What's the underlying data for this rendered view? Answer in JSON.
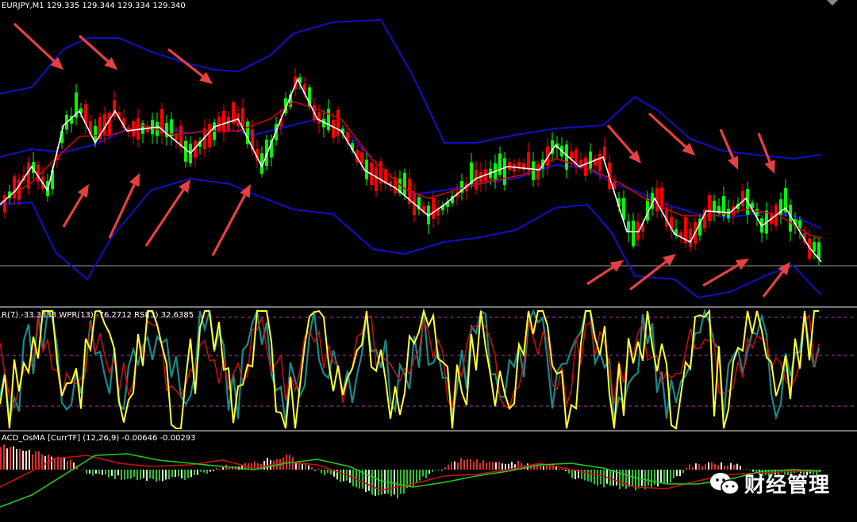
{
  "header": {
    "symbol_line": "EURJPY,M1  129.335 129.344 129.334 129.340"
  },
  "oscillator_header": "R(7) -33.3333  WPR(13) -76.2712  RSI(3) 32.6385",
  "macd_header": "ACD_OsMA [CurrTF] (12,26,9) -0.00646 -0.00293",
  "watermark": {
    "text": "财经管理",
    "icon": "wechat-icon"
  },
  "colors": {
    "bull": "#00ff00",
    "bear": "#ff0000",
    "bb": "#1010c8",
    "ma_fast": "#ffffff",
    "ma_slow": "#d00000",
    "arrow": "#e84040",
    "osc_a": "#ffff30",
    "osc_b": "#1a8a8a",
    "osc_c": "#cc1010",
    "macd_line": "#22cc22",
    "signal_line": "#cc1010",
    "hist_pos": "#e03030",
    "hist_neg": "#30c030",
    "hist_pos_fade": "#ffdddd",
    "hist_neg_fade": "#ccffcc"
  },
  "chart_data": [
    {
      "type": "candlestick",
      "title": "EURJPY,M1",
      "ohlc_header": {
        "open": 129.335,
        "high": 129.344,
        "low": 129.334,
        "close": 129.34
      },
      "indicators": [
        "Bollinger Bands",
        "Moving Average (fast)",
        "Moving Average (slow)"
      ],
      "annotations": "red arrows marking band touches (down arrows at upper band, up arrows at lower band)",
      "current_price_line": true
    },
    {
      "type": "line",
      "series": [
        {
          "name": "R(7)",
          "last": -33.3333
        },
        {
          "name": "WPR(13)",
          "last": -76.2712
        },
        {
          "name": "RSI(3)",
          "last": 32.6385
        }
      ]
    },
    {
      "type": "bar+line",
      "title": "ACD_OsMA [CurrTF] (12,26,9)",
      "series": [
        {
          "name": "MACD",
          "last": -0.00646
        },
        {
          "name": "Signal",
          "last": -0.00293
        }
      ]
    }
  ]
}
